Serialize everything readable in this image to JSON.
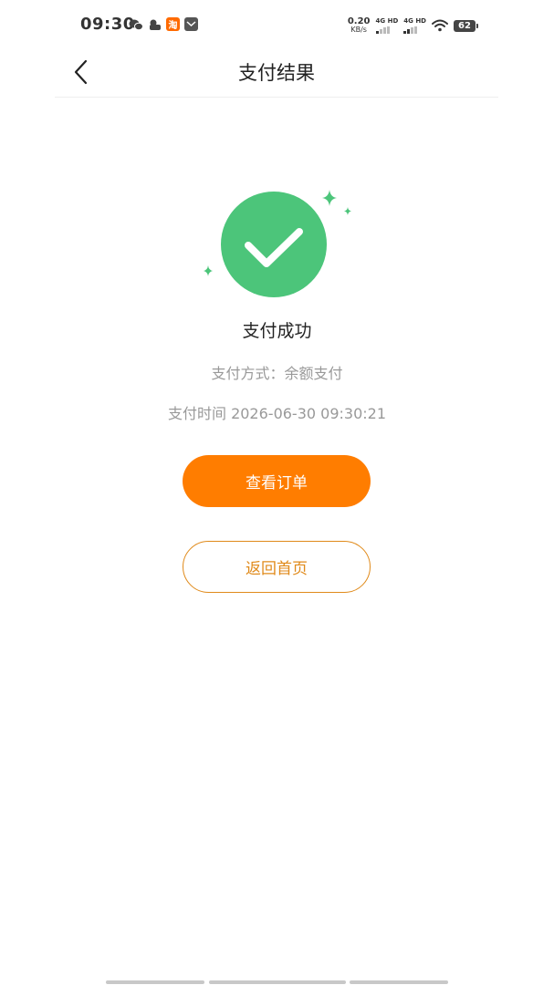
{
  "status_bar": {
    "time": "09:30",
    "net_speed_value": "0.20",
    "net_speed_unit": "KB/s",
    "signal_1_label": "4G HD",
    "signal_2_label": "4G HD",
    "battery_level": "62",
    "notif_taobao_label": "淘"
  },
  "nav": {
    "title": "支付结果"
  },
  "result": {
    "title": "支付成功",
    "method": "支付方式：余额支付",
    "time": "支付时间 2026-06-30 09:30:21"
  },
  "actions": {
    "view_order_label": "查看订单",
    "back_home_label": "返回首页"
  },
  "colors": {
    "primary": "#ff7d00",
    "outline": "#e08a1a",
    "success": "#4cc57a",
    "muted_text": "#999999"
  },
  "icons": [
    "back-chevron-icon",
    "checkmark-icon",
    "sparkle-icon",
    "wechat-icon",
    "taobao-icon",
    "mail-icon",
    "wifi-icon",
    "battery-icon"
  ]
}
